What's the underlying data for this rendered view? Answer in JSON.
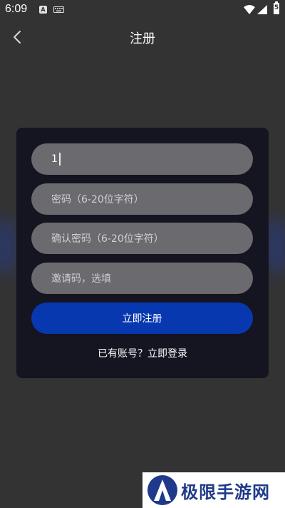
{
  "status_bar": {
    "time": "6:09",
    "battery_text": "5",
    "a_icon_text": "A"
  },
  "header": {
    "title": "注册"
  },
  "form": {
    "account_value": "1",
    "password_placeholder": "密码（6-20位字符）",
    "confirm_password_placeholder": "确认密码（6-20位字符）",
    "invite_code_placeholder": "邀请码，选填",
    "submit_label": "立即注册",
    "login_link": "已有账号？立即登录"
  },
  "watermark": {
    "text": "极限手游网"
  },
  "colors": {
    "background": "#333333",
    "card": "#141521",
    "field": "#6b6b6f",
    "accent": "#0838b0"
  }
}
